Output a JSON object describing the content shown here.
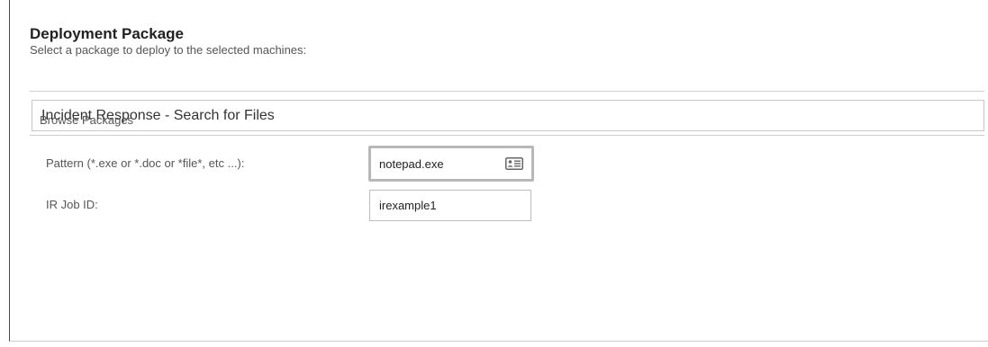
{
  "section": {
    "title": "Deployment Package",
    "subtitle": "Select a package to deploy to the selected machines:"
  },
  "package": {
    "selected": "Incident Response - Search for Files",
    "browse_label": "Browse Packages"
  },
  "fields": {
    "pattern": {
      "label": "Pattern (*.exe or *.doc or *file*, etc ...):",
      "value": "notepad.exe",
      "icon": "contact-card-icon"
    },
    "job_id": {
      "label": "IR Job ID:",
      "value": "irexample1"
    }
  }
}
